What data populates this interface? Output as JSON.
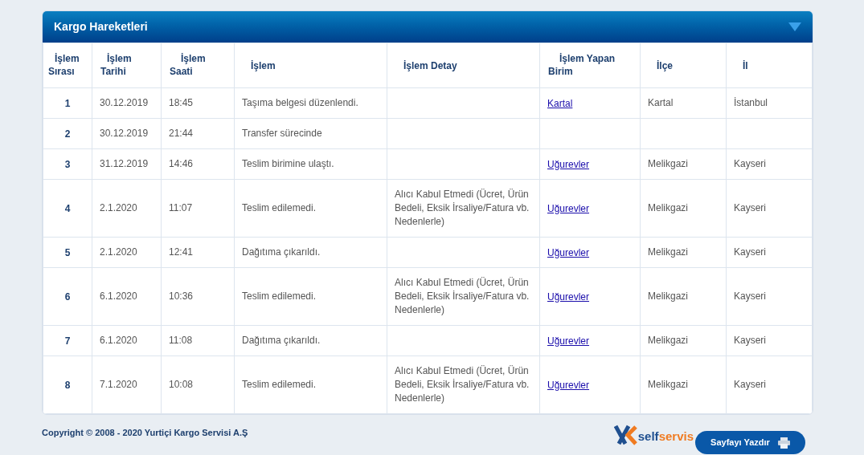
{
  "panel": {
    "title": "Kargo Hareketleri",
    "expanded": true
  },
  "columns": [
    [
      "İşlem",
      "Sırası"
    ],
    [
      "İşlem",
      "Tarihi"
    ],
    [
      "İşlem",
      "Saati"
    ],
    [
      "İşlem"
    ],
    [
      "İşlem Detay"
    ],
    [
      "İşlem Yapan",
      "Birim"
    ],
    [
      "İlçe"
    ],
    [
      "İl"
    ]
  ],
  "rows": [
    {
      "no": "1",
      "date": "30.12.2019",
      "time": "18:45",
      "action": "Taşıma belgesi düzenlendi.",
      "unit": "Kartal",
      "district": "Kartal",
      "city": "İstanbul"
    },
    {
      "no": "2",
      "date": "30.12.2019",
      "time": "21:44",
      "action": "Transfer sürecinde"
    },
    {
      "no": "3",
      "date": "31.12.2019",
      "time": "14:46",
      "action": "Teslim birimine ulaştı.",
      "unit": "Uğurevler",
      "district": "Melikgazi",
      "city": "Kayseri"
    },
    {
      "no": "4",
      "date": "2.1.2020",
      "time": "11:07",
      "action": "Teslim edilemedi.",
      "detail": "Alıcı Kabul Etmedi (Ücret, Ürün Bedeli, Eksik İrsaliye/Fatura vb. Nedenlerle)",
      "unit": "Uğurevler",
      "district": "Melikgazi",
      "city": "Kayseri"
    },
    {
      "no": "5",
      "date": "2.1.2020",
      "time": "12:41",
      "action": "Dağıtıma çıkarıldı.",
      "unit": "Uğurevler",
      "district": "Melikgazi",
      "city": "Kayseri"
    },
    {
      "no": "6",
      "date": "6.1.2020",
      "time": "10:36",
      "action": "Teslim edilemedi.",
      "detail": "Alıcı Kabul Etmedi (Ücret, Ürün Bedeli, Eksik İrsaliye/Fatura vb. Nedenlerle)",
      "unit": "Uğurevler",
      "district": "Melikgazi",
      "city": "Kayseri"
    },
    {
      "no": "7",
      "date": "6.1.2020",
      "time": "11:08",
      "action": "Dağıtıma çıkarıldı.",
      "unit": "Uğurevler",
      "district": "Melikgazi",
      "city": "Kayseri"
    },
    {
      "no": "8",
      "date": "7.1.2020",
      "time": "10:08",
      "action": "Teslim edilemedi.",
      "detail": "Alıcı Kabul Etmedi (Ücret, Ürün Bedeli, Eksik İrsaliye/Fatura vb. Nedenlerle)",
      "unit": "Uğurevler",
      "district": "Melikgazi",
      "city": "Kayseri"
    }
  ],
  "footer": {
    "copyright": "Copyright © 2008 - 2020 Yurtiçi Kargo Servisi A.Ş",
    "logo_prefix": "self",
    "logo_suffix": "servis",
    "print_button": "Sayfayı Yazdır"
  }
}
